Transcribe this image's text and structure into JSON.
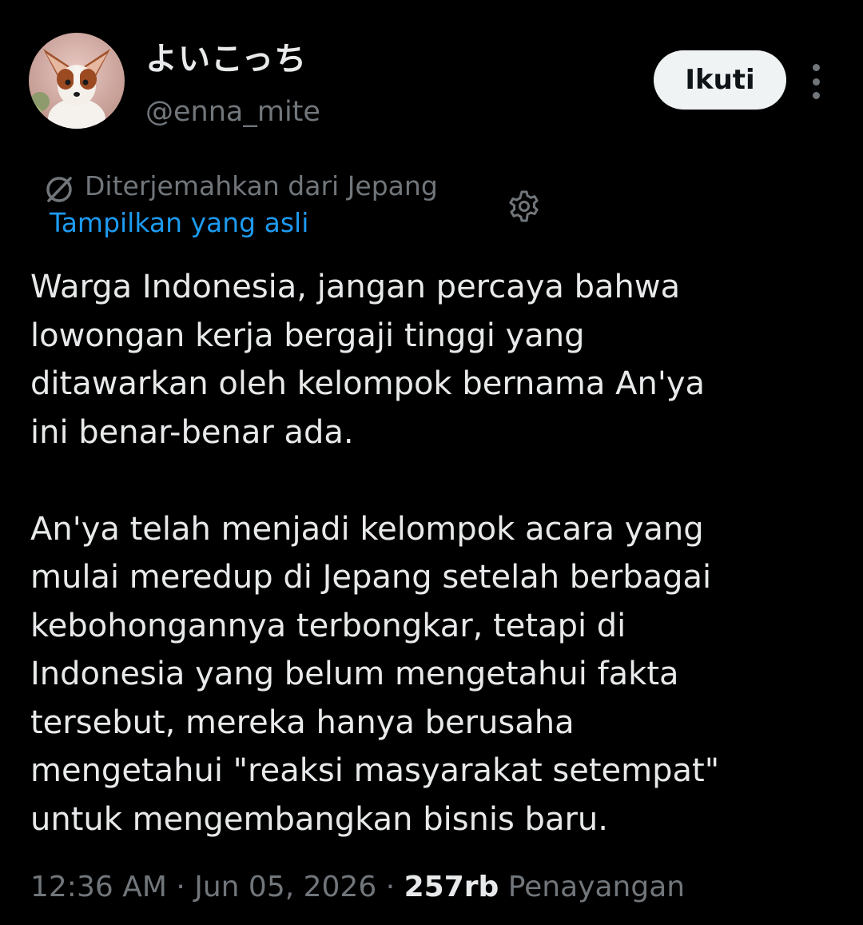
{
  "user": {
    "display_name": "よいこっち",
    "handle": "@enna_mite",
    "avatar_icon": "papillon-dog-avatar"
  },
  "actions": {
    "follow_label": "Ikuti",
    "more_icon": "more-vertical-icon"
  },
  "translation": {
    "label": "Diterjemahkan dari Jepang",
    "show_original": "Tampilkan yang asli",
    "translate_icon": "translate-icon",
    "settings_icon": "gear-icon"
  },
  "tweet": {
    "paragraphs": [
      "Warga Indonesia, jangan percaya bahwa\nlowongan kerja bergaji tinggi yang\nditawarkan oleh kelompok bernama An'ya\nini benar-benar ada.",
      "An'ya telah menjadi kelompok acara yang\nmulai meredup di Jepang setelah berbagai\nkebohongannya terbongkar, tetapi di\nIndonesia yang belum mengetahui fakta\ntersebut, mereka hanya berusaha\nmengetahui \"reaksi masyarakat setempat\"\nuntuk mengembangkan bisnis baru."
    ]
  },
  "meta": {
    "time": "12:36 AM",
    "separator": " · ",
    "date": "Jun 05, 2026",
    "views_count": "257rb",
    "views_label": "Penayangan"
  },
  "colors": {
    "background": "#000000",
    "text": "#e7e9ea",
    "secondary": "#71767b",
    "link": "#1d9bf0",
    "button_bg": "#eff3f4"
  }
}
